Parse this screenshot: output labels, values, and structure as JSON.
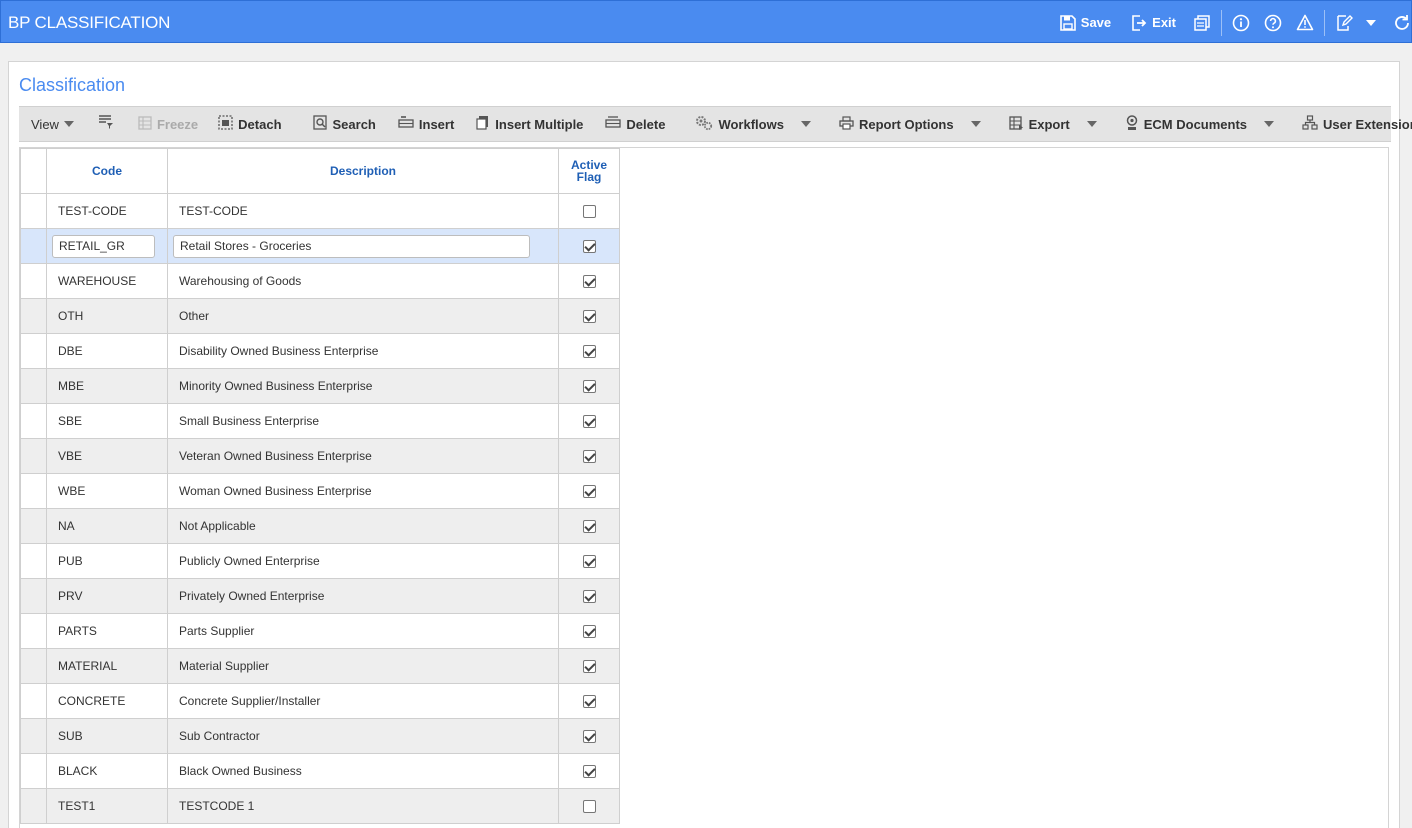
{
  "header": {
    "title": "BP CLASSIFICATION",
    "save_label": "Save",
    "exit_label": "Exit"
  },
  "panel": {
    "title": "Classification"
  },
  "toolbar": {
    "view": "View",
    "freeze": "Freeze",
    "detach": "Detach",
    "search": "Search",
    "insert": "Insert",
    "insert_multiple": "Insert Multiple",
    "delete": "Delete",
    "workflows": "Workflows",
    "report_options": "Report Options",
    "export": "Export",
    "ecm_documents": "ECM Documents",
    "user_extensions": "User Extensions"
  },
  "grid": {
    "columns": {
      "code": "Code",
      "description": "Description",
      "active_line1": "Active",
      "active_line2": "Flag"
    },
    "rows": [
      {
        "code": "TEST-CODE",
        "description": "TEST-CODE",
        "active": false
      },
      {
        "code": "RETAIL_GR",
        "description": "Retail Stores - Groceries",
        "active": true
      },
      {
        "code": "WAREHOUSE",
        "description": "Warehousing of Goods",
        "active": true
      },
      {
        "code": "OTH",
        "description": "Other",
        "active": true
      },
      {
        "code": "DBE",
        "description": "Disability Owned Business Enterprise",
        "active": true
      },
      {
        "code": "MBE",
        "description": "Minority Owned Business Enterprise",
        "active": true
      },
      {
        "code": "SBE",
        "description": "Small Business Enterprise",
        "active": true
      },
      {
        "code": "VBE",
        "description": "Veteran Owned Business Enterprise",
        "active": true
      },
      {
        "code": "WBE",
        "description": "Woman Owned Business Enterprise",
        "active": true
      },
      {
        "code": "NA",
        "description": "Not Applicable",
        "active": true
      },
      {
        "code": "PUB",
        "description": "Publicly Owned Enterprise",
        "active": true
      },
      {
        "code": "PRV",
        "description": "Privately Owned Enterprise",
        "active": true
      },
      {
        "code": "PARTS",
        "description": "Parts Supplier",
        "active": true
      },
      {
        "code": "MATERIAL",
        "description": "Material Supplier",
        "active": true
      },
      {
        "code": "CONCRETE",
        "description": "Concrete Supplier/Installer",
        "active": true
      },
      {
        "code": "SUB",
        "description": "Sub Contractor",
        "active": true
      },
      {
        "code": "BLACK",
        "description": "Black Owned Business",
        "active": true
      },
      {
        "code": "TEST1",
        "description": "TESTCODE 1",
        "active": false
      }
    ]
  },
  "colors": {
    "accent": "#4a8bf0",
    "header_text": "#1f5fb5",
    "selected_row": "#d8e6fb"
  }
}
